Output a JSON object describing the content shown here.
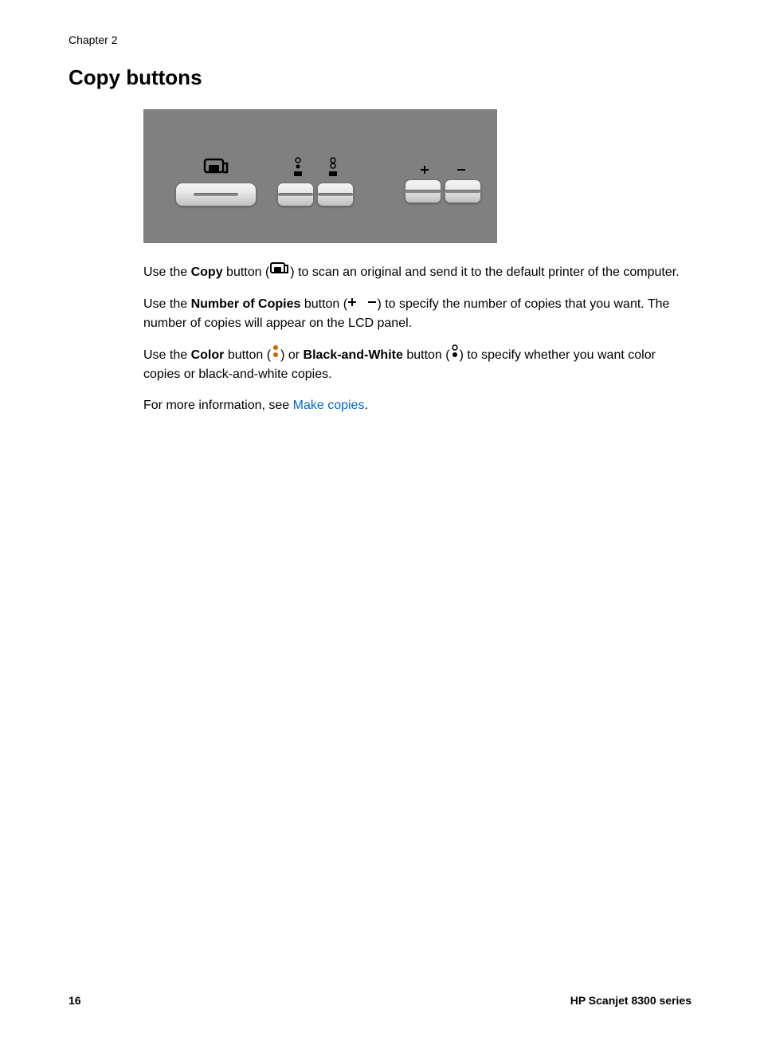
{
  "chapter_label": "Chapter 2",
  "title": "Copy buttons",
  "paragraphs": {
    "p1_a": "Use the ",
    "p1_b": "Copy",
    "p1_c": " button (",
    "p1_d": ") to scan an original and send it to the default printer of the computer.",
    "p2_a": "Use the ",
    "p2_b": "Number of Copies",
    "p2_c": " button (",
    "p2_d": ") to specify the number of copies that you want. The number of copies will appear on the LCD panel.",
    "p3_a": "Use the ",
    "p3_b": "Color",
    "p3_c": " button (",
    "p3_d": ") or ",
    "p3_e": "Black-and-White",
    "p3_f": " button (",
    "p3_g": ") to specify whether you want color copies or black-and-white copies.",
    "p4_a": "For more information, see ",
    "p4_link": "Make copies",
    "p4_b": "."
  },
  "footer": {
    "page_number": "16",
    "product": "HP Scanjet 8300 series"
  }
}
